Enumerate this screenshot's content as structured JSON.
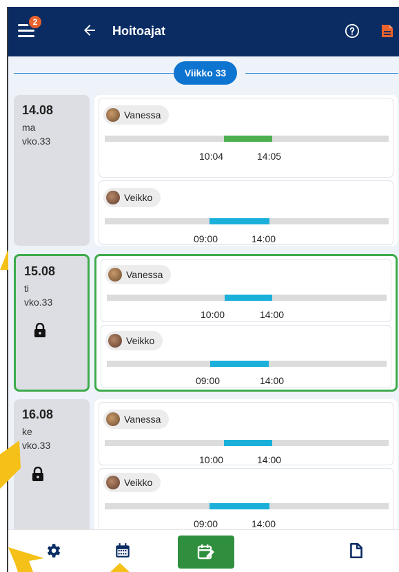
{
  "header": {
    "title": "Hoitoajat",
    "badge_count": "2",
    "menu_icon": "menu-icon",
    "back_icon": "back-arrow-icon",
    "help_icon": "help-icon",
    "document_icon": "document-icon",
    "bg_color": "#0a2c63",
    "badge_color": "#e9622b",
    "document_icon_color": "#e9622b"
  },
  "week": {
    "label": "Viikko 33"
  },
  "days": [
    {
      "date": "14.08",
      "weekday": "ma",
      "week": "vko.33",
      "locked": false,
      "selected": false,
      "entries": [
        {
          "name": "Vanessa",
          "start": "10:04",
          "end": "14:05",
          "bar_color": "#4caf50"
        },
        {
          "name": "Veikko",
          "start": "09:00",
          "end": "14:00",
          "bar_color": "#1bb0da"
        }
      ]
    },
    {
      "date": "15.08",
      "weekday": "ti",
      "week": "vko.33",
      "locked": true,
      "selected": true,
      "entries": [
        {
          "name": "Vanessa",
          "start": "10:00",
          "end": "14:00",
          "bar_color": "#1bb0da"
        },
        {
          "name": "Veikko",
          "start": "09:00",
          "end": "14:00",
          "bar_color": "#1bb0da"
        }
      ]
    },
    {
      "date": "16.08",
      "weekday": "ke",
      "week": "vko.33",
      "locked": true,
      "selected": false,
      "entries": [
        {
          "name": "Vanessa",
          "start": "10:00",
          "end": "14:00",
          "bar_color": "#1bb0da"
        },
        {
          "name": "Veikko",
          "start": "09:00",
          "end": "14:00",
          "bar_color": "#1bb0da"
        }
      ]
    }
  ],
  "bottom_nav": {
    "items": [
      "settings-icon",
      "calendar-icon",
      "edit-calendar-icon",
      "document-icon"
    ],
    "active": "edit-calendar-icon",
    "active_color": "#2f8f3e"
  },
  "colors": {
    "selected_border": "#3dab4b",
    "week_pill": "#0d74d0"
  }
}
